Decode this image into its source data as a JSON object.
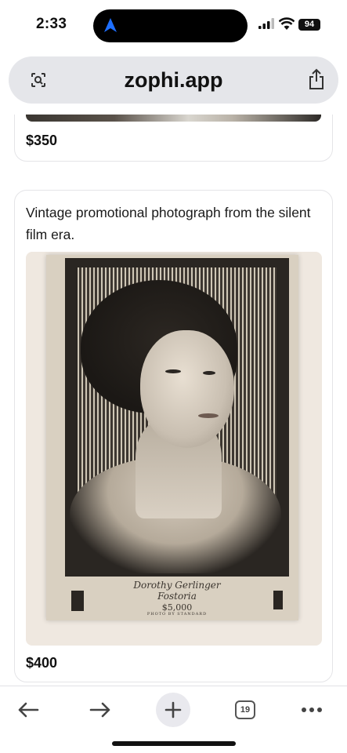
{
  "status_bar": {
    "time": "2:33",
    "battery": "94",
    "icons": [
      "navigation-arrow-icon",
      "signal-icon",
      "wifi-icon",
      "battery-icon"
    ]
  },
  "browser": {
    "url": "zophi.app",
    "icons": [
      "lens-icon",
      "share-icon"
    ],
    "toolbar": {
      "tab_count": "19",
      "icons": [
        "back-icon",
        "forward-icon",
        "plus-icon",
        "tabs-icon",
        "more-icon"
      ]
    }
  },
  "listings": [
    {
      "price": "$350"
    },
    {
      "description": "Vintage promotional photograph from the silent film era.",
      "photo_caption": {
        "name": "Dorothy Gerlinger",
        "place": "Fostoria",
        "amount": "$5,000",
        "credit": "PHOTO BY STANDARD"
      },
      "price": "$400"
    }
  ],
  "colors": {
    "accent": "#1e6fff",
    "background": "#f2f2f4",
    "card_border": "#e4e4e7"
  }
}
